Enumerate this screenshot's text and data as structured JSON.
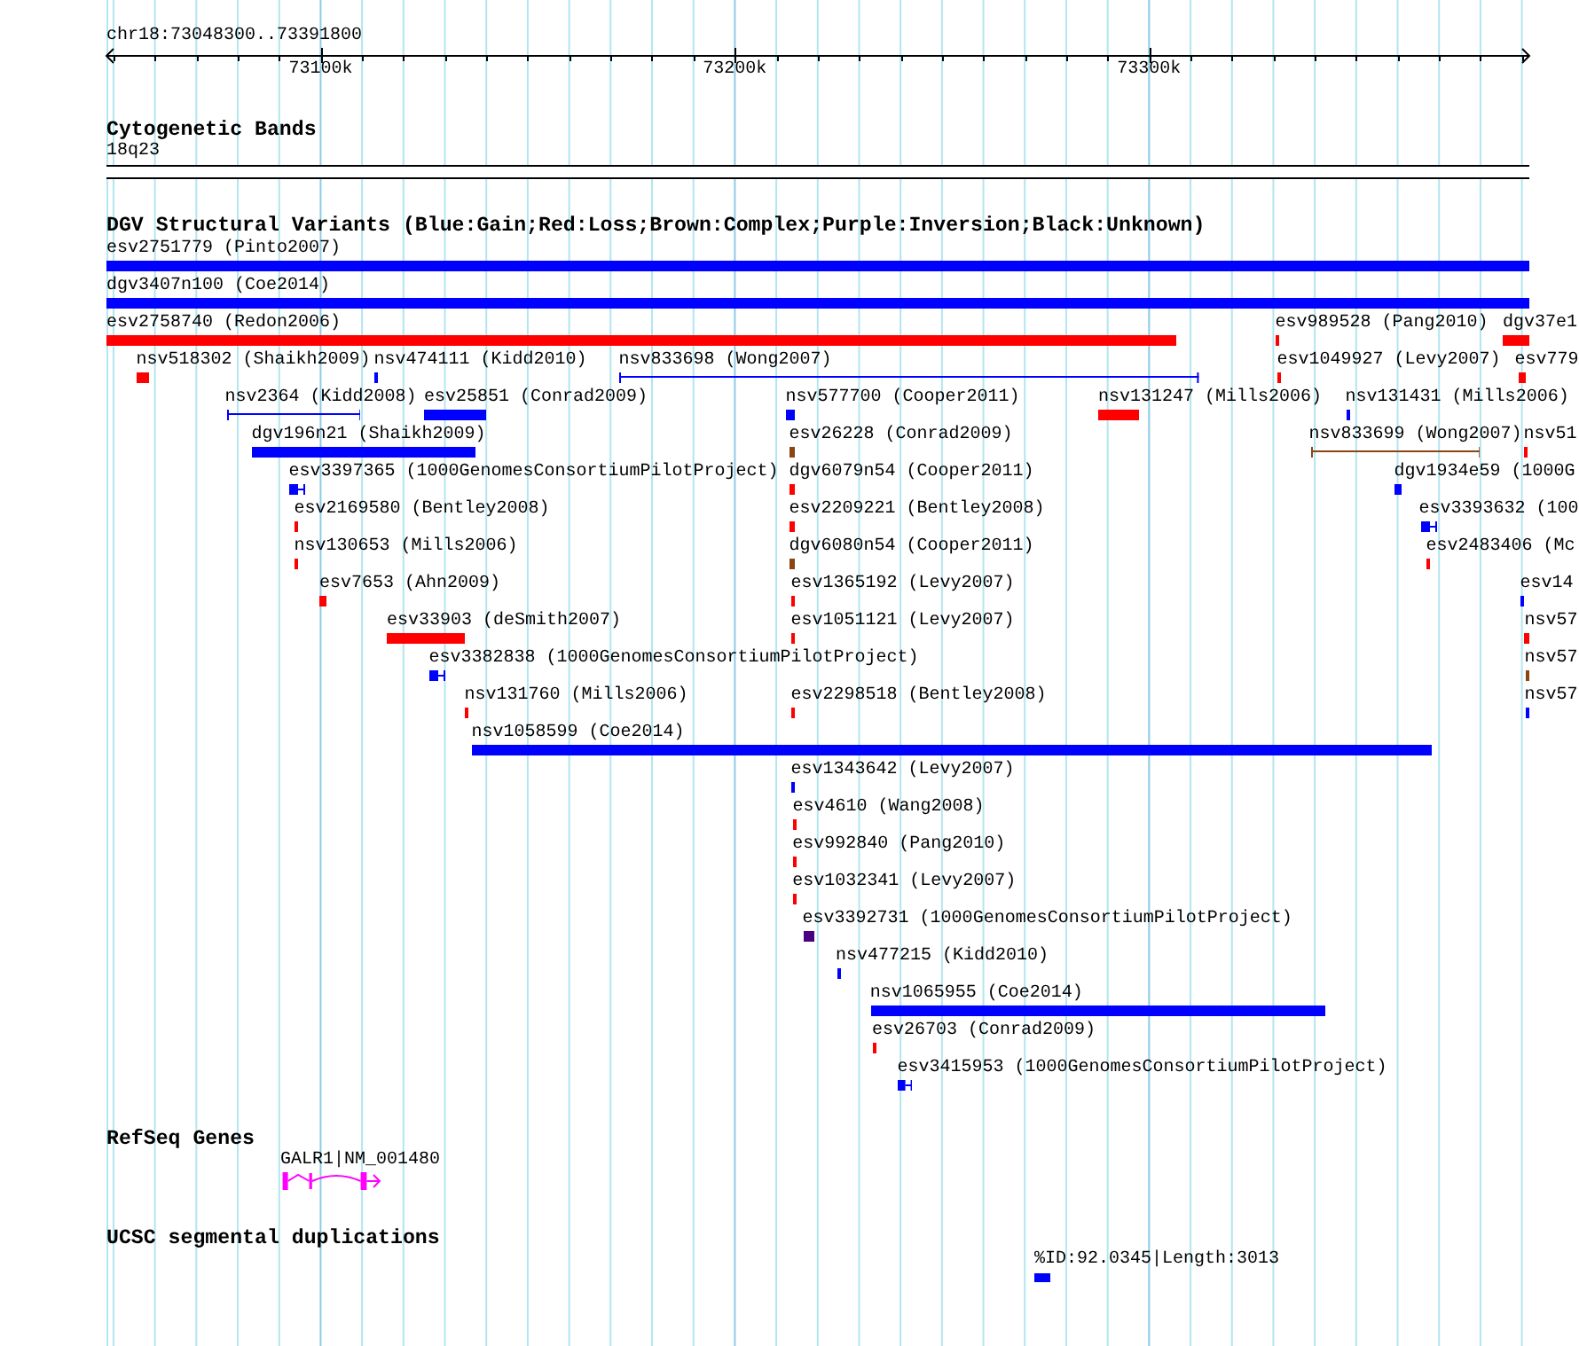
{
  "ruler": {
    "location": "chr18:73048300..73391800",
    "ticks": [
      "73100k",
      "73200k",
      "73300k"
    ]
  },
  "tracks": [
    {
      "kind": "cytoband",
      "title": "Cytogenetic Bands",
      "features": [
        {
          "label": "18q23"
        }
      ]
    },
    {
      "kind": "variants",
      "title": "DGV Structural Variants (Blue:Gain;Red:Loss;Brown:Complex;Purple:Inversion;Black:Unknown)",
      "features": [
        {
          "label": "esv2751779 (Pinto2007)",
          "color": "#0000ff",
          "kind": "bar"
        },
        {
          "label": "dgv3407n100 (Coe2014)",
          "color": "#0000ff",
          "kind": "bar"
        },
        {
          "label": "esv2758740 (Redon2006)",
          "color": "#ff0000",
          "kind": "bar"
        },
        {
          "label": "esv989528 (Pang2010)",
          "color": "#ff0000",
          "kind": "bar"
        },
        {
          "label": "dgv37e1",
          "color": "#ff0000",
          "kind": "bar"
        },
        {
          "label": "nsv518302 (Shaikh2009)",
          "color": "#ff0000",
          "kind": "bar"
        },
        {
          "label": "nsv474111 (Kidd2010)",
          "color": "#0000ff",
          "kind": "bar"
        },
        {
          "label": "nsv833698 (Wong2007)",
          "color": "#0000ff",
          "kind": "range"
        },
        {
          "label": "esv1049927 (Levy2007)",
          "color": "#ff0000",
          "kind": "bar"
        },
        {
          "label": "esv779",
          "color": "#ff0000",
          "kind": "bar"
        },
        {
          "label": "nsv2364 (Kidd2008)",
          "color": "#0000ff",
          "kind": "range"
        },
        {
          "label": "esv25851 (Conrad2009)",
          "color": "#0000ff",
          "kind": "bar"
        },
        {
          "label": "nsv577700 (Cooper2011)",
          "color": "#0000ff",
          "kind": "bar"
        },
        {
          "label": "nsv131247 (Mills2006)",
          "color": "#ff0000",
          "kind": "bar"
        },
        {
          "label": "nsv131431 (Mills2006)",
          "color": "#0000ff",
          "kind": "bar"
        },
        {
          "label": "dgv196n21 (Shaikh2009)",
          "color": "#0000ff",
          "kind": "bar"
        },
        {
          "label": "esv26228 (Conrad2009)",
          "color": "#8b4513",
          "kind": "bar"
        },
        {
          "label": "nsv833699 (Wong2007)",
          "color": "#8b4513",
          "kind": "range"
        },
        {
          "label": "nsv51",
          "color": "#ff0000",
          "kind": "bar"
        },
        {
          "label": "esv3397365 (1000GenomesConsortiumPilotProject)",
          "color": "#0000ff",
          "kind": "capped"
        },
        {
          "label": "dgv6079n54 (Cooper2011)",
          "color": "#ff0000",
          "kind": "bar"
        },
        {
          "label": "dgv1934e59 (1000G",
          "color": "#0000ff",
          "kind": "bar"
        },
        {
          "label": "esv2169580 (Bentley2008)",
          "color": "#ff0000",
          "kind": "bar"
        },
        {
          "label": "esv2209221 (Bentley2008)",
          "color": "#ff0000",
          "kind": "bar"
        },
        {
          "label": "esv3393632 (100",
          "color": "#0000ff",
          "kind": "capped"
        },
        {
          "label": "nsv130653 (Mills2006)",
          "color": "#ff0000",
          "kind": "bar"
        },
        {
          "label": "dgv6080n54 (Cooper2011)",
          "color": "#8b4513",
          "kind": "bar"
        },
        {
          "label": "esv2483406 (Mc",
          "color": "#ff0000",
          "kind": "bar"
        },
        {
          "label": "esv7653 (Ahn2009)",
          "color": "#ff0000",
          "kind": "bar"
        },
        {
          "label": "esv1365192 (Levy2007)",
          "color": "#ff0000",
          "kind": "bar"
        },
        {
          "label": "esv14",
          "color": "#0000ff",
          "kind": "bar"
        },
        {
          "label": "esv33903 (deSmith2007)",
          "color": "#ff0000",
          "kind": "bar"
        },
        {
          "label": "esv1051121 (Levy2007)",
          "color": "#ff0000",
          "kind": "bar"
        },
        {
          "label": "nsv57",
          "color": "#ff0000",
          "kind": "bar"
        },
        {
          "label": "esv3382838 (1000GenomesConsortiumPilotProject)",
          "color": "#0000ff",
          "kind": "capped"
        },
        {
          "label": "nsv57",
          "color": "#8b4513",
          "kind": "bar"
        },
        {
          "label": "nsv131760 (Mills2006)",
          "color": "#ff0000",
          "kind": "bar"
        },
        {
          "label": "esv2298518 (Bentley2008)",
          "color": "#ff0000",
          "kind": "bar"
        },
        {
          "label": "nsv57",
          "color": "#0000ff",
          "kind": "bar"
        },
        {
          "label": "nsv1058599 (Coe2014)",
          "color": "#0000ff",
          "kind": "bar"
        },
        {
          "label": "esv1343642 (Levy2007)",
          "color": "#0000ff",
          "kind": "bar"
        },
        {
          "label": "esv4610 (Wang2008)",
          "color": "#ff0000",
          "kind": "bar"
        },
        {
          "label": "esv992840 (Pang2010)",
          "color": "#ff0000",
          "kind": "bar"
        },
        {
          "label": "esv1032341 (Levy2007)",
          "color": "#ff0000",
          "kind": "bar"
        },
        {
          "label": "esv3392731 (1000GenomesConsortiumPilotProject)",
          "color": "#4b0082",
          "kind": "bar"
        },
        {
          "label": "nsv477215 (Kidd2010)",
          "color": "#0000ff",
          "kind": "bar"
        },
        {
          "label": "nsv1065955 (Coe2014)",
          "color": "#0000ff",
          "kind": "bar"
        },
        {
          "label": "esv26703 (Conrad2009)",
          "color": "#ff0000",
          "kind": "bar"
        },
        {
          "label": "esv3415953 (1000GenomesConsortiumPilotProject)",
          "color": "#0000ff",
          "kind": "capped"
        }
      ]
    },
    {
      "kind": "gene",
      "title": "RefSeq Genes",
      "features": [
        {
          "label": "GALR1|NM_001480"
        }
      ]
    },
    {
      "kind": "segment",
      "title": "UCSC segmental duplications",
      "features": [
        {
          "label": "%ID:92.0345|Length:3013"
        }
      ]
    }
  ]
}
